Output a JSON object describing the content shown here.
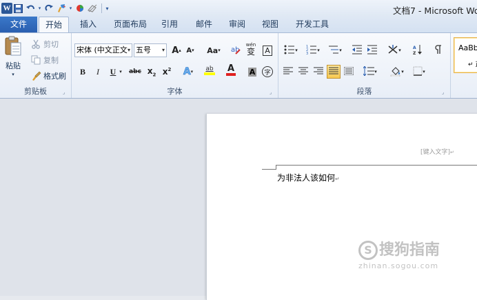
{
  "window": {
    "title": "文档7 - Microsoft Wo"
  },
  "qat": {
    "logo": "W",
    "icons": [
      "save-icon",
      "undo-icon",
      "redo-icon",
      "format-painter-icon",
      "color-icon",
      "eraser-icon",
      "customize-icon"
    ]
  },
  "tabs": {
    "file": "文件",
    "items": [
      "开始",
      "插入",
      "页面布局",
      "引用",
      "邮件",
      "审阅",
      "视图",
      "开发工具"
    ]
  },
  "clipboard": {
    "paste": "粘贴",
    "cut": "剪切",
    "copy": "复制",
    "format_painter": "格式刷",
    "label": "剪贴板"
  },
  "font": {
    "name": "宋体 (中文正文",
    "size": "五号",
    "label": "字体",
    "grow": "A",
    "shrink": "A",
    "case": "Aa",
    "phonetic": "wén",
    "phonetic_char": "变",
    "border_char": "A",
    "bold": "B",
    "italic": "I",
    "underline": "U",
    "strike": "abc",
    "subscript": "x",
    "superscript": "x",
    "effects": "A",
    "highlight": "ab",
    "color": "A",
    "shade": "A",
    "enclose": "字"
  },
  "paragraph": {
    "label": "段落"
  },
  "styles": {
    "preview": "AaBb",
    "name": "正"
  },
  "document": {
    "header_text": "[键入文字]",
    "body_text": "为非法人该如何"
  },
  "watermark": {
    "text": "搜狗指南",
    "url": "zhinan.sogou.com"
  },
  "colors": {
    "file_tab": "#2a5fb0",
    "highlight": "#f7c94f",
    "font_red": "#e02020",
    "highlight_yellow": "#ffff00"
  }
}
